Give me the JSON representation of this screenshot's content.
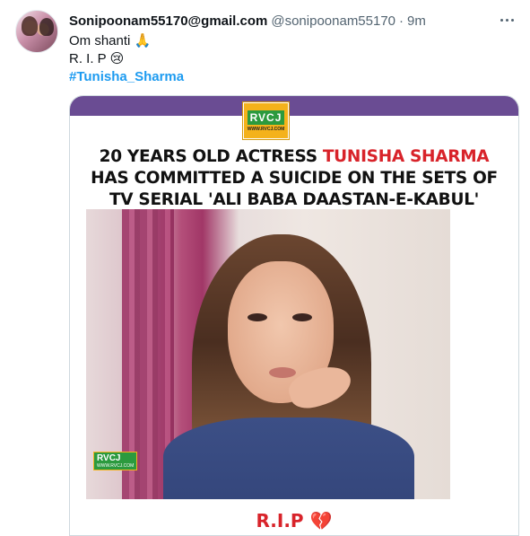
{
  "user": {
    "display_name": "Sonipoonam55170@gmail.com",
    "handle": "@sonipoonam55170",
    "separator": "·",
    "time": "9m",
    "avatar": "avatar"
  },
  "tweet": {
    "line1": "Om shanti 🙏",
    "line2": "R. I. P 😢",
    "hashtag": "#Tunisha_Sharma"
  },
  "media": {
    "logo_text": "RVCJ",
    "logo_url": "WWW.RVCJ.COM",
    "headline_part1": "20 YEARS OLD ACTRESS ",
    "headline_highlight": "TUNISHA SHARMA",
    "headline_line2": "HAS COMMITTED A SUICIDE ON THE SETS OF",
    "headline_line3": "TV SERIAL 'ALI BABA DAASTAN-E-KABUL'",
    "watermark_text": "RVCJ",
    "watermark_url": "WWW.RVCJ.COM",
    "footer_text": "R.I.P",
    "footer_icon": "💔",
    "colors": {
      "top_bar": "#6a4c93",
      "highlight": "#d8232a",
      "logo_bg": "#f4b21b",
      "logo_accent": "#2b9a3e"
    }
  },
  "icons": {
    "more": "more-icon"
  }
}
